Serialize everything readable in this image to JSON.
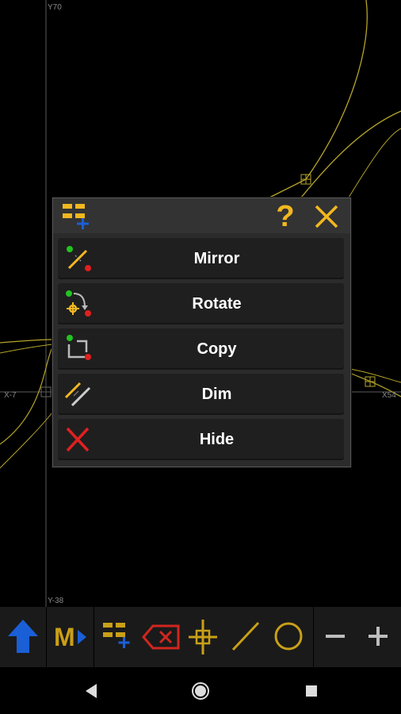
{
  "canvas": {
    "axis_labels": {
      "top": "Y70",
      "bottom": "Y-38",
      "left": "X-7",
      "right": "X54"
    },
    "colors": {
      "curve": "#b5a42a",
      "axis": "#5a5a5a"
    }
  },
  "dialog": {
    "header_icons": [
      "grid-add-icon",
      "help-icon",
      "close-icon"
    ],
    "help_label": "?",
    "items": [
      {
        "label": "Mirror",
        "icon": "mirror-icon"
      },
      {
        "label": "Rotate",
        "icon": "rotate-icon"
      },
      {
        "label": "Copy",
        "icon": "copy-icon"
      },
      {
        "label": "Dim",
        "icon": "dim-icon"
      },
      {
        "label": "Hide",
        "icon": "hide-icon"
      }
    ],
    "colors": {
      "accent": "#f2b81f",
      "text": "#ffffff",
      "red": "#e02020",
      "blue": "#1a5fd6",
      "green": "#22c322"
    }
  },
  "toolbar": {
    "buttons": [
      "up-arrow-icon",
      "menu-m-icon",
      "grid-add-icon",
      "delete-icon",
      "crosshair-icon",
      "line-icon",
      "circle-icon",
      "zoom-out-icon",
      "zoom-in-icon"
    ],
    "m_label": "M",
    "colors": {
      "blue": "#1a5fd6",
      "gold": "#c9a017",
      "red": "#d0261f",
      "gray": "#bdbdbd"
    }
  },
  "navbar": {
    "buttons": [
      "back-icon",
      "home-icon",
      "recents-icon"
    ]
  }
}
